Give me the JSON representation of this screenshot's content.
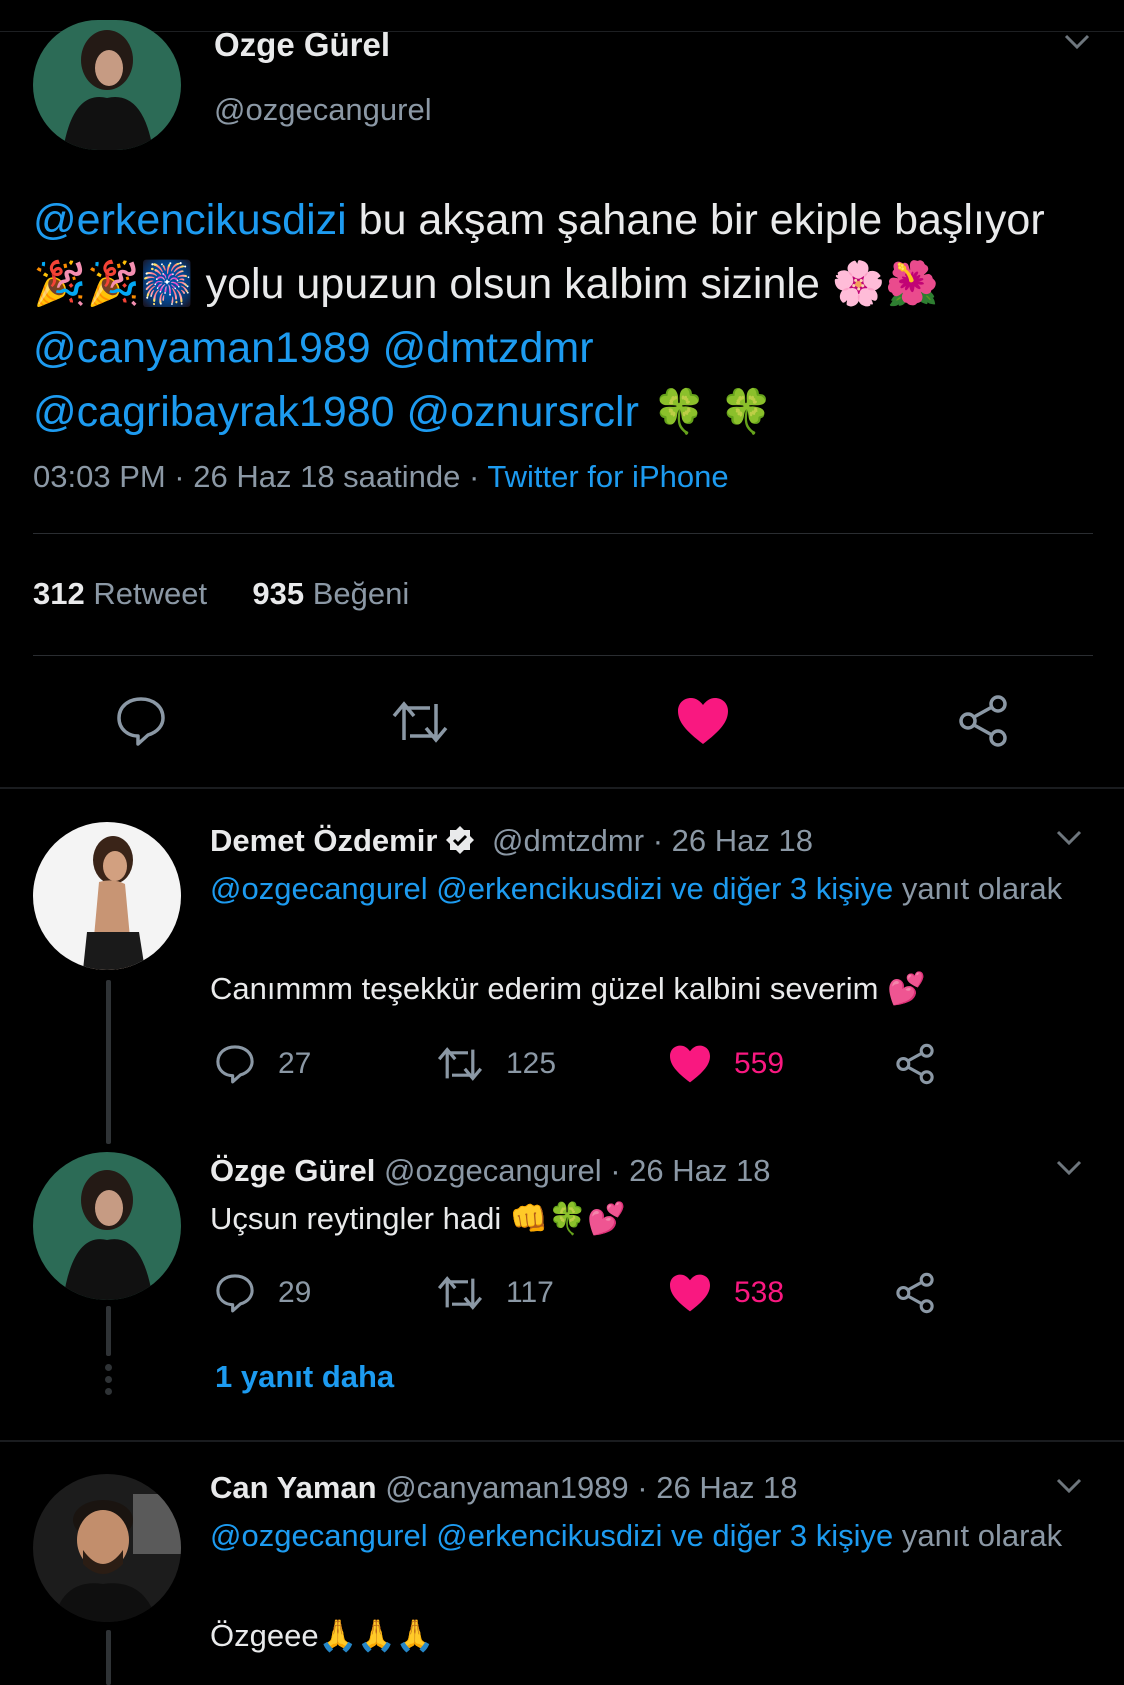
{
  "main_tweet": {
    "author_name": "Ozge Gürel",
    "author_handle": "@ozgecangurel",
    "mention_1": "@erkencikusdizi",
    "text_1": " bu akşam şahane bir ekiple başlıyor ",
    "emoji_1": "🎉🎉🎆",
    "text_2": " yolu upuzun olsun kalbim sizinle ",
    "emoji_2": "🌸🌺",
    "mention_2": "@canyaman1989",
    "mention_3": " @dmtzdmr",
    "mention_4": "@cagribayrak1980",
    "mention_5": " @oznursrclr",
    "emoji_3": " 🍀 🍀",
    "time": "03:03 PM · 26 Haz 18 saatinde · ",
    "source": "Twitter for iPhone",
    "retweet_count": "312",
    "retweet_label": "Retweet",
    "like_count": "935",
    "like_label": "Beğeni"
  },
  "replies": [
    {
      "author_name": "Demet Özdemir",
      "author_handle": "@dmtzdmr",
      "date": " · 26 Haz 18",
      "replying_to": "@ozgecangurel @erkencikusdizi ve diğer 3 kişiye",
      "replying_suffix": " yanıt olarak",
      "text": "Canımmm teşekkür ederim güzel kalbini severim ",
      "text_emoji": "💕",
      "comments": "27",
      "retweets": "125",
      "likes": "559"
    },
    {
      "author_name": "Özge Gürel",
      "author_handle": "@ozgecangurel",
      "date": " · 26 Haz 18",
      "text": "Uçsun reytingler hadi ",
      "text_emoji": "👊🍀💕",
      "comments": "29",
      "retweets": "117",
      "likes": "538"
    },
    {
      "author_name": "Can Yaman",
      "author_handle": "@canyaman1989",
      "date": " · 26 Haz 18",
      "replying_to": "@ozgecangurel @erkencikusdizi ve diğer 3 kişiye",
      "replying_suffix": " yanıt olarak",
      "text": "Özgeee",
      "text_emoji": "🙏🙏🙏"
    }
  ],
  "more_replies_link": "1 yanıt daha",
  "icons": {
    "reply": "comment-bubble-icon",
    "retweet": "retweet-icon",
    "like": "heart-icon",
    "share": "share-icon",
    "verified": "verified-badge-icon",
    "caret": "chevron-down-icon"
  },
  "colors": {
    "background": "#000000",
    "accent": "#1d9bf0",
    "like": "#f91880",
    "muted": "#8b98a5"
  }
}
